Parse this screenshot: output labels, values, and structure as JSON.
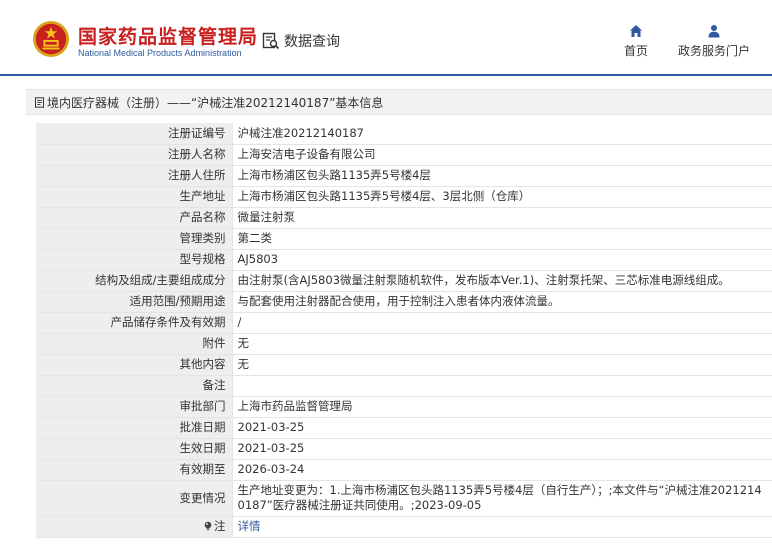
{
  "header": {
    "logo_cn": "国家药品监督管理局",
    "logo_en": "National Medical Products Administration",
    "query_label": "数据查询",
    "nav": {
      "home": "首页",
      "portal": "政务服务门户"
    }
  },
  "breadcrumb": {
    "text": "境内医疗器械（注册）——“沪械注准20212140187”基本信息"
  },
  "rows": [
    {
      "label": "注册证编号",
      "value": "沪械注准20212140187"
    },
    {
      "label": "注册人名称",
      "value": "上海安洁电子设备有限公司"
    },
    {
      "label": "注册人住所",
      "value": "上海市杨浦区包头路1135弄5号楼4层"
    },
    {
      "label": "生产地址",
      "value": "上海市杨浦区包头路1135弄5号楼4层、3层北侧（仓库）"
    },
    {
      "label": "产品名称",
      "value": "微量注射泵"
    },
    {
      "label": "管理类别",
      "value": "第二类"
    },
    {
      "label": "型号规格",
      "value": "AJ5803"
    },
    {
      "label": "结构及组成/主要组成成分",
      "value": "由注射泵(含AJ5803微量注射泵随机软件，发布版本Ver.1)、注射泵托架、三芯标准电源线组成。"
    },
    {
      "label": "适用范围/预期用途",
      "value": "与配套使用注射器配合使用，用于控制注入患者体内液体流量。"
    },
    {
      "label": "产品储存条件及有效期",
      "value": "/"
    },
    {
      "label": "附件",
      "value": "无"
    },
    {
      "label": "其他内容",
      "value": "无"
    },
    {
      "label": "备注",
      "value": ""
    },
    {
      "label": "审批部门",
      "value": "上海市药品监督管理局"
    },
    {
      "label": "批准日期",
      "value": "2021-03-25"
    },
    {
      "label": "生效日期",
      "value": "2021-03-25"
    },
    {
      "label": "有效期至",
      "value": "2026-03-24"
    },
    {
      "label": "变更情况",
      "value": "生产地址变更为：1.上海市杨浦区包头路1135弄5号楼4层（自行生产）；;本文件与“沪械注准20212140187”医疗器械注册证共同使用。;2023-09-05"
    }
  ],
  "note": {
    "label": "注",
    "link": "详情"
  },
  "colors": {
    "brand_red": "#c81f1f",
    "brand_blue": "#2f5a9e",
    "label_bg": "#eeeeee"
  },
  "icons": {
    "emblem": "national-emblem-icon",
    "query": "data-query-icon",
    "home": "home-icon",
    "portal": "user-icon",
    "breadcrumb": "document-icon",
    "note": "bulb-icon"
  }
}
